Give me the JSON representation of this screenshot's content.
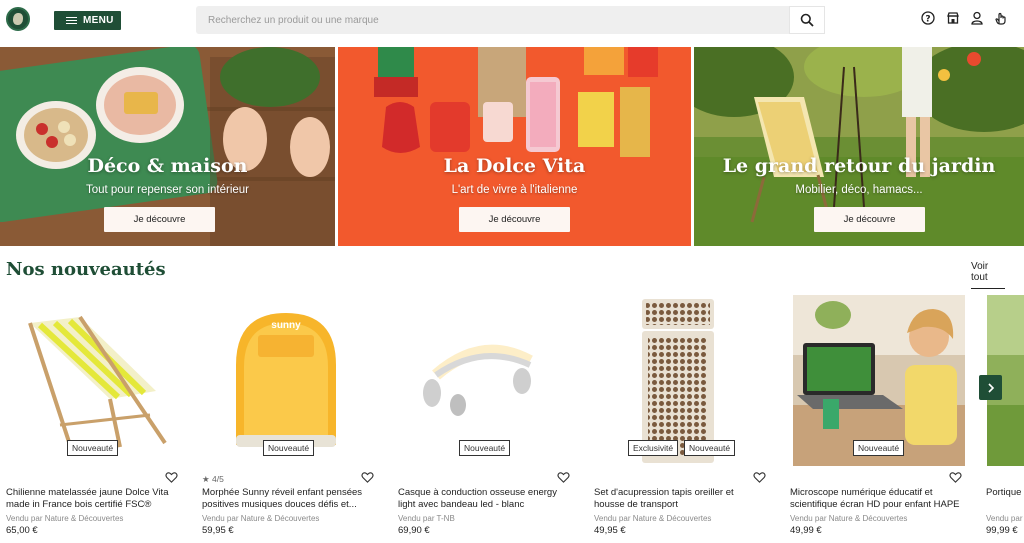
{
  "header": {
    "logo_icon": "globe-logo-icon",
    "menu_label": "MENU",
    "search_placeholder": "Recherchez un produit ou une marque",
    "icons": [
      "help-icon",
      "store-icon",
      "account-icon",
      "hand-icon"
    ]
  },
  "banners": [
    {
      "title": "Déco & maison",
      "subtitle": "Tout pour repenser son intérieur",
      "button": "Je découvre"
    },
    {
      "title": "La Dolce Vita",
      "subtitle": "L'art de vivre à l'italienne",
      "button": "Je découvre"
    },
    {
      "title": "Le grand retour du jardin",
      "subtitle": "Mobilier, déco, hamacs...",
      "button": "Je découvre"
    }
  ],
  "section": {
    "title": "Nos nouveautés",
    "see_all": "Voir tout"
  },
  "products": [
    {
      "badges": [
        "Nouveauté"
      ],
      "rating": "",
      "name": "Chilienne matelassée jaune Dolce Vita made in France bois certifié FSC®",
      "vendor": "Vendu par Nature & Découvertes",
      "price": "65,00 €"
    },
    {
      "badges": [
        "Nouveauté"
      ],
      "rating": "★ 4/5",
      "name": "Morphée Sunny réveil enfant pensées positives musiques douces défis et...",
      "vendor": "Vendu par Nature & Découvertes",
      "price": "59,95 €"
    },
    {
      "badges": [
        "Nouveauté"
      ],
      "rating": "",
      "name": "Casque à conduction osseuse energy light avec bandeau led - blanc",
      "vendor": "Vendu par T-NB",
      "price": "69,90 €"
    },
    {
      "badges": [
        "Exclusivité",
        "Nouveauté"
      ],
      "rating": "",
      "name": "Set d'acupression tapis oreiller et housse de transport",
      "vendor": "Vendu par Nature & Découvertes",
      "price": "49,95 €"
    },
    {
      "badges": [
        "Nouveauté"
      ],
      "rating": "",
      "name": "Microscope numérique éducatif et scientifique écran HD pour enfant HAPE",
      "vendor": "Vendu par Nature & Découvertes",
      "price": "49,99 €"
    },
    {
      "badges": [],
      "rating": "",
      "name": "Portique e",
      "vendor": "Vendu par",
      "price": "99,99 €"
    }
  ],
  "colors": {
    "brand_green": "#1f4e36",
    "banner_orange": "#f2592d"
  }
}
